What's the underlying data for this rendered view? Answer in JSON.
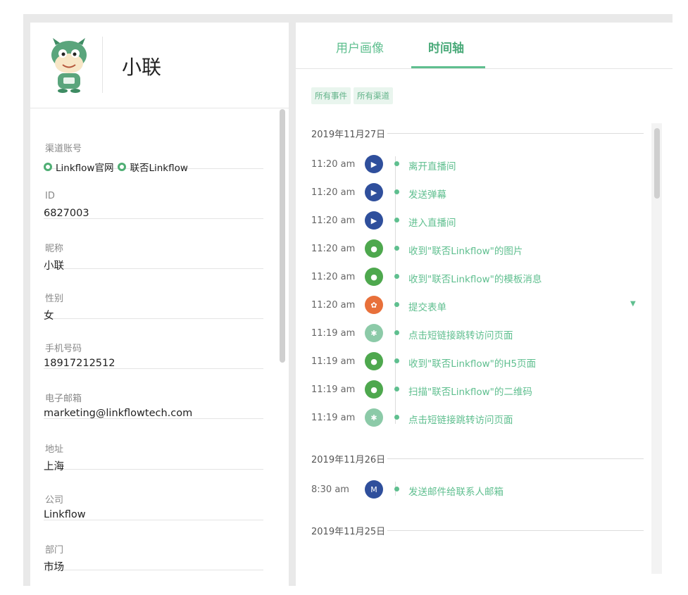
{
  "profile": {
    "name": "小联"
  },
  "fields": [
    {
      "label": "渠道账号",
      "channels": [
        "Linkflow官网",
        "联否Linkflow"
      ]
    },
    {
      "label": "ID",
      "value": "6827003"
    },
    {
      "label": "昵称",
      "value": "小联"
    },
    {
      "label": "性别",
      "value": "女"
    },
    {
      "label": "手机号码",
      "value": "18917212512"
    },
    {
      "label": "电子邮箱",
      "value": "marketing@linkflowtech.com"
    },
    {
      "label": "地址",
      "value": "上海"
    },
    {
      "label": "公司",
      "value": "Linkflow"
    },
    {
      "label": "部门",
      "value": "市场"
    }
  ],
  "tabs": [
    {
      "label": "用户画像",
      "active": false
    },
    {
      "label": "时间轴",
      "active": true
    }
  ],
  "filters": [
    "所有事件",
    "所有渠道"
  ],
  "timeline": {
    "groups": [
      {
        "date": "2019年11月27日",
        "events": [
          {
            "time": "11:20 am",
            "icon": "play-icon",
            "text": "离开直播间"
          },
          {
            "time": "11:20 am",
            "icon": "play-icon",
            "text": "发送弹幕"
          },
          {
            "time": "11:20 am",
            "icon": "play-icon",
            "text": "进入直播间"
          },
          {
            "time": "11:20 am",
            "icon": "wechat-icon",
            "text": "收到\"联否Linkflow\"的图片"
          },
          {
            "time": "11:20 am",
            "icon": "wechat-icon",
            "text": "收到\"联否Linkflow\"的模板消息"
          },
          {
            "time": "11:20 am",
            "icon": "form-icon",
            "text": "提交表单",
            "expandable": true
          },
          {
            "time": "11:19 am",
            "icon": "link-icon",
            "text": "点击短链接跳转访问页面"
          },
          {
            "time": "11:19 am",
            "icon": "wechat-icon",
            "text": "收到\"联否Linkflow\"的H5页面"
          },
          {
            "time": "11:19 am",
            "icon": "wechat-icon",
            "text": "扫描\"联否Linkflow\"的二维码"
          },
          {
            "time": "11:19 am",
            "icon": "link-icon",
            "text": "点击短链接跳转访问页面"
          }
        ]
      },
      {
        "date": "2019年11月26日",
        "events": [
          {
            "time": "8:30 am",
            "icon": "mail-icon",
            "text": "发送邮件给联系人邮箱"
          }
        ]
      },
      {
        "date": "2019年11月25日",
        "events": []
      }
    ]
  },
  "colors": {
    "accent": "#5fbf8f",
    "play": "#2f4f9c",
    "wechat": "#4ea84e",
    "form": "#e8703a"
  }
}
